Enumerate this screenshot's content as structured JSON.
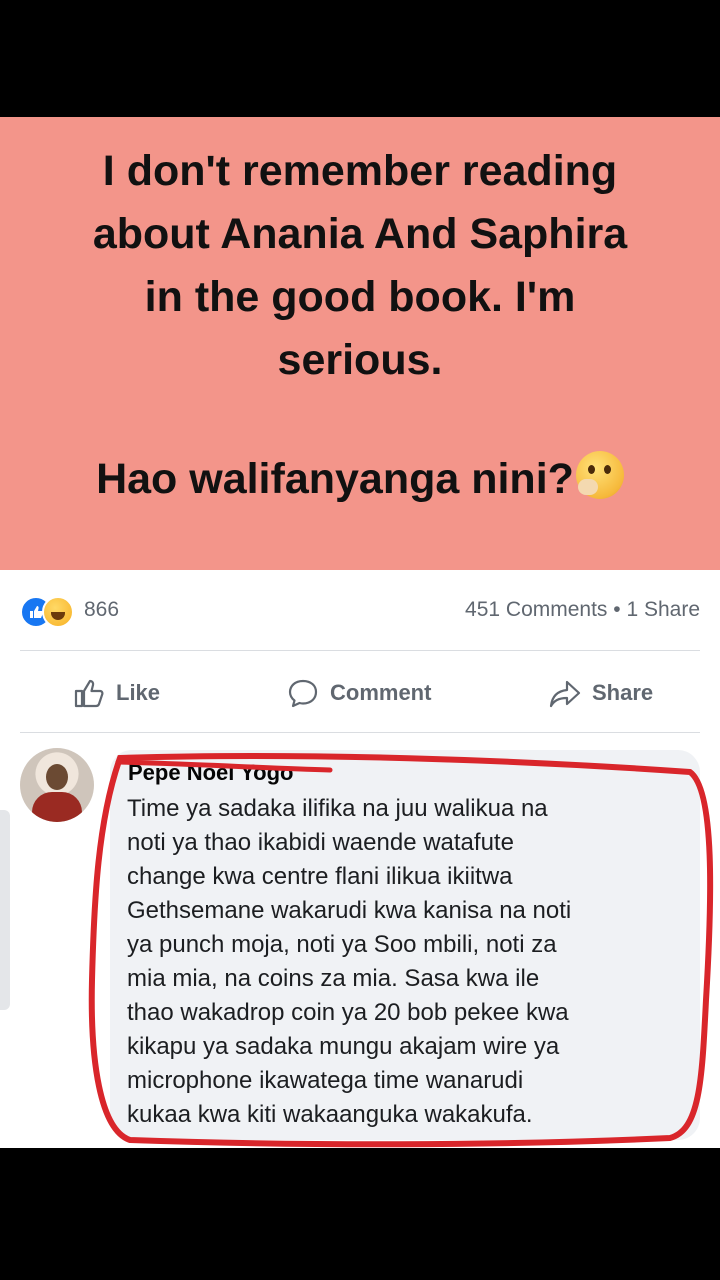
{
  "post": {
    "text_lines": [
      "I don't remember reading",
      "about Anania And Saphira",
      "in the good book. I'm",
      "serious."
    ],
    "question": "Hao walifanyanga nini?",
    "question_emoji": "thinking-face-emoji",
    "background_color": "#f3958a"
  },
  "stats": {
    "reaction_icons": [
      "like-icon",
      "haha-icon"
    ],
    "reaction_count": "866",
    "comments_share": "451 Comments • 1 Share"
  },
  "actions": {
    "like_label": "Like",
    "comment_label": "Comment",
    "share_label": "Share"
  },
  "comment": {
    "author": "Pepe Noel Yogo",
    "lines": [
      "Time ya sadaka ilifika na juu walikua na",
      "noti ya thao ikabidi waende watafute",
      "change kwa centre flani ilikua ikiitwa",
      "Gethsemane wakarudi kwa kanisa na noti",
      "ya punch moja, noti ya Soo mbili, noti za",
      "mia mia, na coins za mia. Sasa kwa ile",
      "thao wakadrop coin ya 20 bob pekee kwa",
      "kikapu ya sadaka mungu akajam wire ya",
      "microphone ikawatega time wanarudi",
      "kukaa kwa kiti wakaanguka wakakufa."
    ],
    "annotation_color": "#d9262b"
  }
}
